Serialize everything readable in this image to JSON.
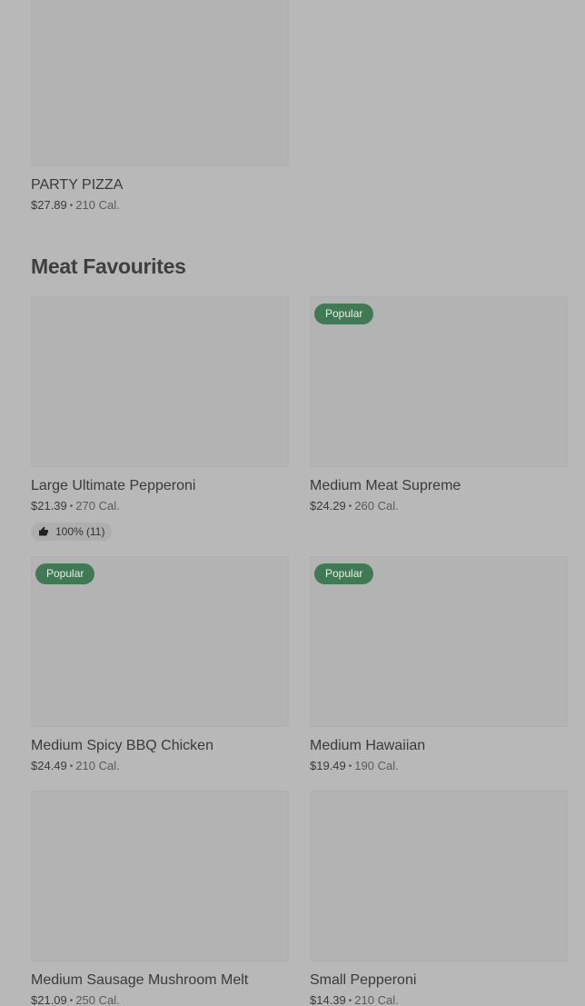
{
  "party": {
    "title": "PARTY PIZZA",
    "price": "$27.89",
    "calories": "210 Cal."
  },
  "section": {
    "heading": "Meat Favourites"
  },
  "items": [
    {
      "title": "Large Ultimate Pepperoni",
      "price": "$21.39",
      "calories": "270 Cal.",
      "rating": "100% (11)"
    },
    {
      "title": "Medium Meat Supreme",
      "price": "$24.29",
      "calories": "260 Cal.",
      "badge": "Popular"
    },
    {
      "title": "Medium Spicy BBQ Chicken",
      "price": "$24.49",
      "calories": "210 Cal.",
      "badge": "Popular"
    },
    {
      "title": "Medium Hawaiian",
      "price": "$19.49",
      "calories": "190 Cal.",
      "badge": "Popular"
    },
    {
      "title": "Medium Sausage Mushroom Melt",
      "price": "$21.09",
      "calories": "250 Cal."
    },
    {
      "title": "Small Pepperoni",
      "price": "$14.39",
      "calories": "210 Cal."
    }
  ],
  "separator": "•",
  "icons": {
    "rating": "thumbs-up-icon"
  }
}
